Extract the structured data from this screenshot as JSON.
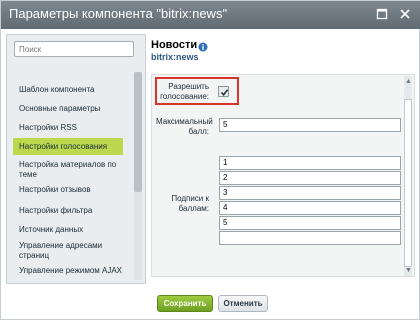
{
  "window": {
    "title": "Параметры компонента \"bitrix:news\""
  },
  "sidebar": {
    "search_placeholder": "Поиск",
    "items": [
      {
        "label": "Шаблон компонента",
        "active": false
      },
      {
        "label": "Основные параметры",
        "active": false
      },
      {
        "label": "Настройки RSS",
        "active": false
      },
      {
        "label": "Настройки голосования",
        "active": true
      },
      {
        "label": "Настройка материалов по теме",
        "active": false
      },
      {
        "label": "Настройки отзывов",
        "active": false
      },
      {
        "label": "Настройки фильтра",
        "active": false
      },
      {
        "label": "Источник данных",
        "active": false
      },
      {
        "label": "Управление адресами страниц",
        "active": false
      },
      {
        "label": "Управление режимом AJAX",
        "active": false
      }
    ]
  },
  "content": {
    "title": "Новости",
    "subtitle": "bitrix:news",
    "allow_voting": {
      "label": "Разрешить голосование:",
      "checked": true
    },
    "max_score": {
      "label": "Максимальный балл:",
      "value": "5"
    },
    "score_captions": {
      "label": "Подписи к баллам:",
      "values": [
        "1",
        "2",
        "3",
        "4",
        "5",
        ""
      ]
    }
  },
  "footer": {
    "save_label": "Сохранить",
    "cancel_label": "Отменить"
  },
  "colors": {
    "titlebar": "#6b767e",
    "active_item": "#bcd84f",
    "save_button": "#86b52f",
    "highlight_border": "#d9342b"
  }
}
